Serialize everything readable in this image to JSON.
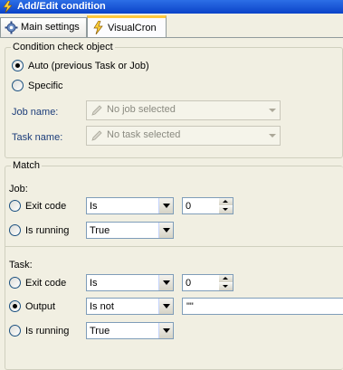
{
  "window": {
    "title": "Add/Edit condition"
  },
  "tabs": [
    {
      "label": "Main settings"
    },
    {
      "label": "VisualCron"
    }
  ],
  "condition_check_object": {
    "legend": "Condition check object",
    "auto_label": "Auto (previous Task or Job)",
    "specific_label": "Specific",
    "job_name_label": "Job name:",
    "job_name_placeholder": "No job selected",
    "task_name_label": "Task name:",
    "task_name_placeholder": "No task selected"
  },
  "match": {
    "legend": "Match",
    "job": {
      "heading": "Job:",
      "exit_code_label": "Exit code",
      "exit_code_operator": "Is",
      "exit_code_value": "0",
      "is_running_label": "Is running",
      "is_running_value": "True"
    },
    "task": {
      "heading": "Task:",
      "exit_code_label": "Exit code",
      "exit_code_operator": "Is",
      "exit_code_value": "0",
      "output_label": "Output",
      "output_operator": "Is not",
      "output_value": "\"\"",
      "is_running_label": "Is running",
      "is_running_value": "True"
    }
  }
}
